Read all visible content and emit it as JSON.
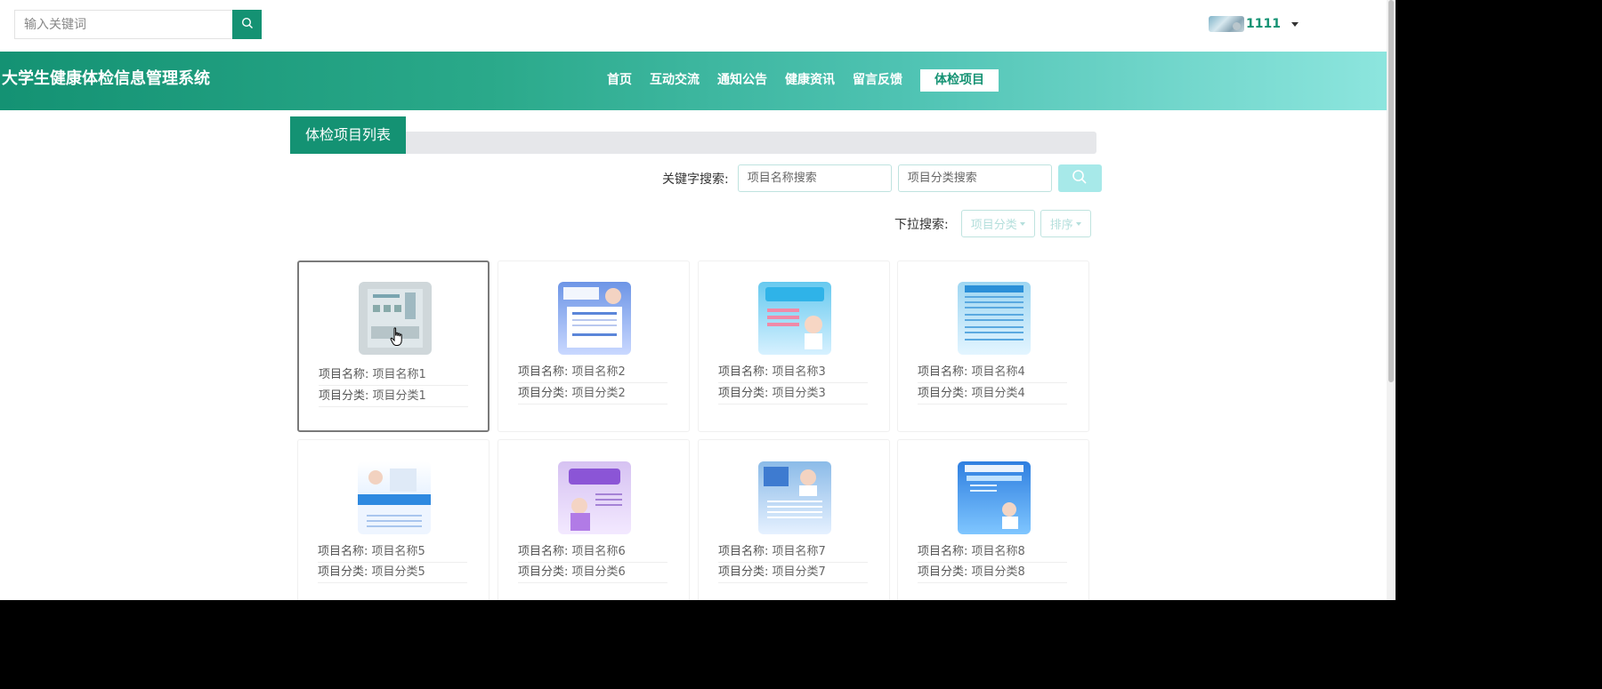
{
  "top_search": {
    "placeholder": "输入关键词"
  },
  "user": {
    "name": "1111"
  },
  "header": {
    "title": "大学生健康体检信息管理系统",
    "nav": [
      {
        "label": "首页"
      },
      {
        "label": "互动交流"
      },
      {
        "label": "通知公告"
      },
      {
        "label": "健康资讯"
      },
      {
        "label": "留言反馈"
      },
      {
        "label": "体检项目",
        "active": true
      }
    ]
  },
  "list": {
    "title": "体检项目列表"
  },
  "keyword_search": {
    "label": "关键字搜索:",
    "name_placeholder": "项目名称搜索",
    "category_placeholder": "项目分类搜索"
  },
  "dropdown_search": {
    "label": "下拉搜索:",
    "category_label": "项目分类",
    "sort_label": "排序"
  },
  "item_labels": {
    "name_key": "项目名称:",
    "category_key": "项目分类:"
  },
  "items": [
    {
      "name": "项目名称1",
      "category": "项目分类1"
    },
    {
      "name": "项目名称2",
      "category": "项目分类2"
    },
    {
      "name": "项目名称3",
      "category": "项目分类3"
    },
    {
      "name": "项目名称4",
      "category": "项目分类4"
    },
    {
      "name": "项目名称5",
      "category": "项目分类5"
    },
    {
      "name": "项目名称6",
      "category": "项目分类6"
    },
    {
      "name": "项目名称7",
      "category": "项目分类7"
    },
    {
      "name": "项目名称8",
      "category": "项目分类8"
    }
  ],
  "colors": {
    "primary": "#149273",
    "accent_light": "#a7e9e9"
  }
}
